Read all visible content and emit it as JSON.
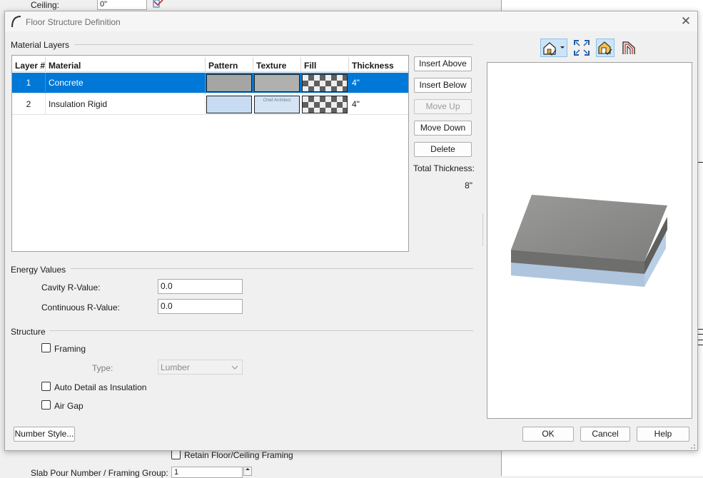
{
  "background": {
    "ceiling_label": "Ceiling:",
    "ceiling_value": "0\"",
    "retain_label": "Retain Floor/Ceiling Framing",
    "slab_label": "Slab Pour Number / Framing Group:",
    "slab_value": "1"
  },
  "dialog": {
    "title": "Floor Structure Definition",
    "close_icon": "close-icon"
  },
  "material_layers": {
    "group_label": "Material Layers",
    "columns": [
      "Layer #",
      "Material",
      "Pattern",
      "Texture",
      "Fill",
      "Thickness"
    ],
    "rows": [
      {
        "layer": "1",
        "material": "Concrete",
        "thickness": "4\"",
        "pattern_color": "#a5a5a3",
        "texture_color": "#b0b0ae",
        "selected": true
      },
      {
        "layer": "2",
        "material": "Insulation Rigid",
        "thickness": "4\"",
        "pattern_color": "#c7dcf2",
        "texture_color": "#d4e4f5",
        "selected": false
      }
    ],
    "texture_caption": "Chief Architect",
    "buttons": {
      "insert_above": "Insert Above",
      "insert_below": "Insert Below",
      "move_up": "Move Up",
      "move_down": "Move Down",
      "delete": "Delete"
    },
    "total_thickness_label": "Total Thickness:",
    "total_thickness_value": "8\""
  },
  "energy": {
    "group_label": "Energy Values",
    "cavity_label": "Cavity R-Value:",
    "cavity_value": "0.0",
    "continuous_label": "Continuous R-Value:",
    "continuous_value": "0.0"
  },
  "structure": {
    "group_label": "Structure",
    "framing_label": "Framing",
    "type_label": "Type:",
    "type_value": "Lumber",
    "auto_detail_label": "Auto Detail as Insulation",
    "air_gap_label": "Air Gap"
  },
  "footer": {
    "number_style": "Number Style...",
    "ok": "OK",
    "cancel": "Cancel",
    "help": "Help"
  },
  "preview_toolbar": {
    "icons": [
      "camera-view-icon",
      "fill-window-icon",
      "materials-view-icon",
      "layers-icon"
    ]
  },
  "colors": {
    "selection": "#0078d7",
    "concrete_top": "#8f8f8d",
    "concrete_side": "#6e6e6c",
    "insulation": "#b9cfe6"
  }
}
